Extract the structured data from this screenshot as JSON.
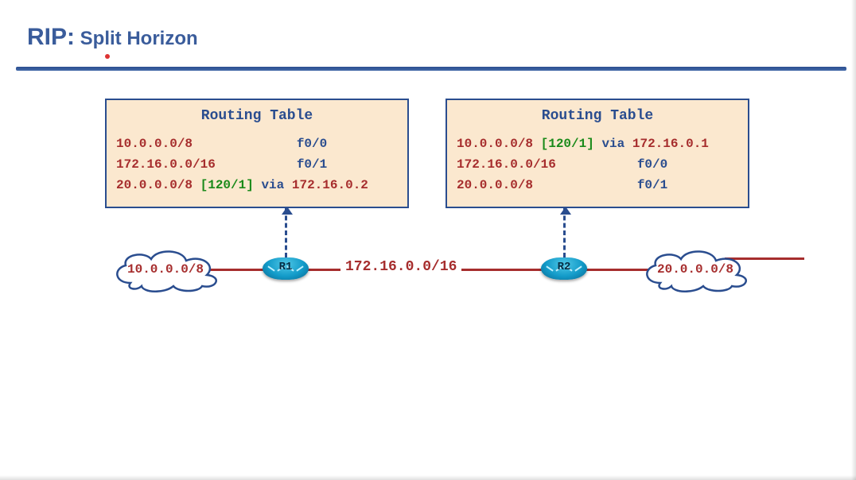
{
  "title": {
    "main": "RIP:",
    "sub": " Split Horizon"
  },
  "tables": {
    "left": {
      "title": "Routing Table",
      "rows": [
        {
          "net": "10.0.0.0/8",
          "iface": "f0/0",
          "metric": "",
          "via": "",
          "nh": ""
        },
        {
          "net": "172.16.0.0/16",
          "iface": "f0/1",
          "metric": "",
          "via": "",
          "nh": ""
        },
        {
          "net": "20.0.0.0/8",
          "iface": "",
          "metric": "[120/1]",
          "via": "via",
          "nh": "172.16.0.2"
        }
      ]
    },
    "right": {
      "title": "Routing Table",
      "rows": [
        {
          "net": "10.0.0.0/8",
          "iface": "",
          "metric": "[120/1]",
          "via": "via",
          "nh": "172.16.0.1"
        },
        {
          "net": "172.16.0.0/16",
          "iface": "f0/0",
          "metric": "",
          "via": "",
          "nh": ""
        },
        {
          "net": "20.0.0.0/8",
          "iface": "f0/1",
          "metric": "",
          "via": "",
          "nh": ""
        }
      ]
    }
  },
  "topology": {
    "cloud_left": "10.0.0.0/8",
    "cloud_right": "20.0.0.0/8",
    "middle": "172.16.0.0/16",
    "r1": "R1",
    "r2": "R2"
  }
}
